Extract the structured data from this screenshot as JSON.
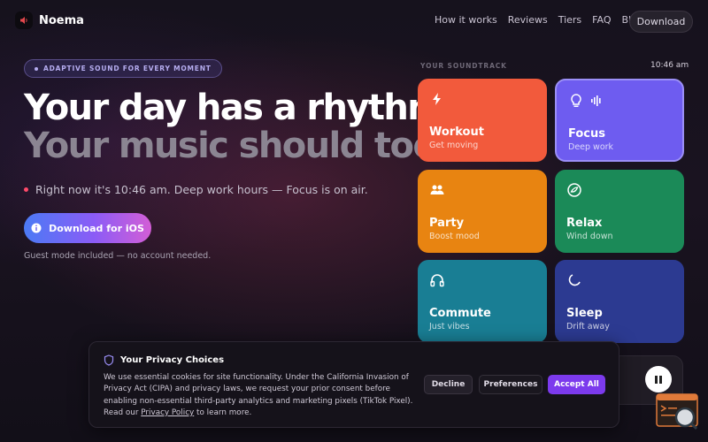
{
  "nav": {
    "brand": "Noema",
    "links": [
      "How it works",
      "Reviews",
      "Tiers",
      "FAQ",
      "Blog"
    ],
    "download": "Download"
  },
  "hero": {
    "pill": "ADAPTIVE SOUND FOR EVERY MOMENT",
    "headline_1": "Your day has a rhythm.",
    "headline_2": "Your music should too.",
    "status": "Right now it's 10:46 am. Deep work hours — Focus is on air.",
    "cta": "Download for iOS",
    "guest_note": "Guest mode included — no account needed."
  },
  "soundtrack": {
    "label": "YOUR SOUNDTRACK",
    "time": "10:46 am",
    "cards": [
      {
        "title": "Workout",
        "subtitle": "Get moving",
        "icon": "lightning-icon",
        "color": "#f25a3c"
      },
      {
        "title": "Focus",
        "subtitle": "Deep work",
        "icon": "lightbulb-icon",
        "color": "#6e5cf0"
      },
      {
        "title": "Party",
        "subtitle": "Boost mood",
        "icon": "people-icon",
        "color": "#e88411"
      },
      {
        "title": "Relax",
        "subtitle": "Wind down",
        "icon": "leaf-icon",
        "color": "#1b8a58"
      },
      {
        "title": "Commute",
        "subtitle": "Just vibes",
        "icon": "headphones-icon",
        "color": "#197e94"
      },
      {
        "title": "Sleep",
        "subtitle": "Drift away",
        "icon": "moon-icon",
        "color": "#2c3a91"
      }
    ]
  },
  "cookie": {
    "title": "Your Privacy Choices",
    "body": "We use essential cookies for site functionality. Under the California Invasion of Privacy Act (CIPA) and privacy laws, we request your prior consent before enabling non-essential third-party analytics and marketing pixels (TikTok Pixel). Read our ",
    "link": "Privacy Policy",
    "body_end": " to learn more.",
    "decline": "Decline",
    "preferences": "Preferences",
    "accept": "Accept All"
  },
  "colors": {
    "accent": "#7c3aed",
    "status_dot": "#ff4a6a"
  }
}
